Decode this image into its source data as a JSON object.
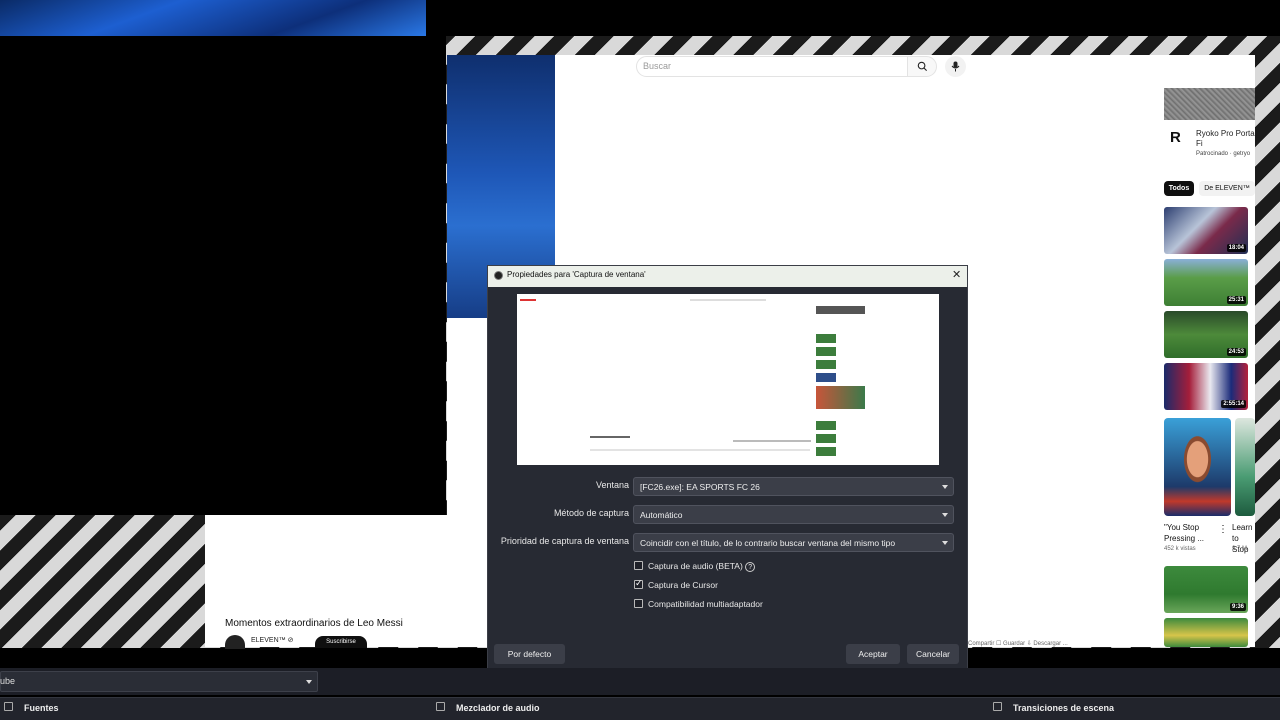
{
  "youtube": {
    "search_placeholder": "Buscar",
    "ad_title": "Ryoko Pro Porta Fi",
    "ad_sponsored": "Patrocinado · getryo",
    "ad_logo": "R",
    "chips": [
      "Todos",
      "De ELEVEN™"
    ],
    "thumbnails": [
      {
        "duration": "18:04"
      },
      {
        "duration": "25:31"
      },
      {
        "duration": "24:53"
      },
      {
        "duration": "2:55:14"
      },
      {
        "duration": "9:36"
      }
    ],
    "shorts": [
      {
        "title": "\"You Stop Pressing ...",
        "views": "452 k vistas"
      },
      {
        "title": "Learn to Stop",
        "views": "2.7 M"
      }
    ],
    "video_title": "Momentos extraordinarios de Leo Messi",
    "channel_name": "ELEVEN™ ⊘",
    "subscribe_label": "Suscribirse",
    "actions": "Compartir   ☐ Guardar   ⇩ Descargar   ..."
  },
  "dialog": {
    "title": "Propiedades para 'Captura de ventana'",
    "fields": {
      "window_label": "Ventana",
      "window_value": "[FC26.exe]: EA SPORTS FC 26",
      "method_label": "Método de captura",
      "method_value": "Automático",
      "priority_label": "Prioridad de captura de ventana",
      "priority_value": "Coincidir con el título, de lo contrario buscar ventana del mismo tipo"
    },
    "checkboxes": [
      {
        "label": "Captura de audio (BETA)",
        "checked": false
      },
      {
        "label": "Captura de Cursor",
        "checked": true
      },
      {
        "label": "Compatibilidad multiadaptador",
        "checked": false
      }
    ],
    "buttons": {
      "defaults": "Por defecto",
      "accept": "Aceptar",
      "cancel": "Cancelar"
    }
  },
  "obs": {
    "scene_combo_value": "ube",
    "docks": [
      "Fuentes",
      "Mezclador de audio",
      "Transiciones de escena"
    ]
  }
}
